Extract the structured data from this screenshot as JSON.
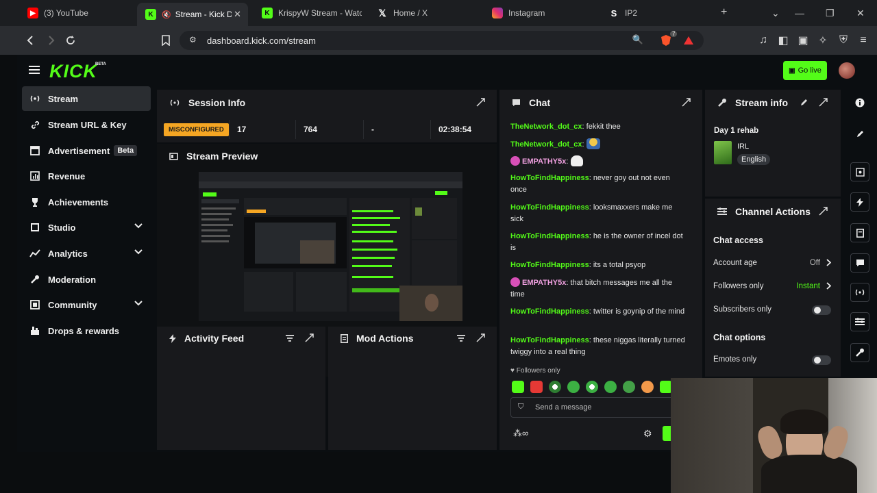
{
  "browser": {
    "tabs": [
      {
        "label": "(3) YouTube",
        "icon": "youtube-icon",
        "color": "#ff0000"
      },
      {
        "label": "Stream - Kick Dashboard",
        "icon": "kick-icon",
        "color": "#53fc18",
        "active": true
      },
      {
        "label": "KrispyW Stream - Watch",
        "icon": "kick-icon",
        "color": "#53fc18"
      },
      {
        "label": "Home / X",
        "icon": "x-icon",
        "color": "#ffffff"
      },
      {
        "label": "Instagram",
        "icon": "instagram-icon",
        "color": "#e1306c"
      },
      {
        "label": "IP2",
        "icon": "s-icon",
        "color": "#ffffff"
      }
    ],
    "url": "dashboard.kick.com/stream",
    "extension_count": "7"
  },
  "app": {
    "logo": "KICK",
    "logo_badge": "BETA",
    "go_live_label": "Go live",
    "accent": "#53fc18"
  },
  "sidebar": {
    "items": [
      {
        "label": "Stream",
        "icon": "broadcast-icon"
      },
      {
        "label": "Stream URL & Key",
        "icon": "link-icon"
      },
      {
        "label": "Advertisement",
        "badge": "Beta",
        "icon": "ad-icon"
      },
      {
        "label": "Revenue",
        "icon": "bar-chart-icon"
      },
      {
        "label": "Achievements",
        "icon": "trophy-icon"
      },
      {
        "label": "Studio",
        "icon": "studio-icon"
      },
      {
        "label": "Analytics",
        "icon": "analytics-icon"
      },
      {
        "label": "Moderation",
        "icon": "wrench-icon"
      },
      {
        "label": "Community",
        "icon": "community-icon"
      },
      {
        "label": "Drops & rewards",
        "icon": "drops-icon"
      }
    ]
  },
  "session": {
    "title": "Session Info",
    "status": "MISCONFIGURED",
    "stat1": "17",
    "stat2": "764",
    "stat3": "-",
    "duration": "02:38:54"
  },
  "preview": {
    "title": "Stream Preview"
  },
  "activity": {
    "title": "Activity Feed"
  },
  "mod_actions": {
    "title": "Mod Actions"
  },
  "chat": {
    "title": "Chat",
    "messages": [
      {
        "user": "TheNetwork_dot_cx",
        "text": "fekkit thee"
      },
      {
        "user": "TheNetwork_dot_cx",
        "text": ""
      },
      {
        "user": "EMPATHY5x",
        "text": ""
      },
      {
        "user": "HowToFindHappiness",
        "text": "never goy out not even once"
      },
      {
        "user": "HowToFindHappiness",
        "text": "looksmaxxers make me sick"
      },
      {
        "user": "HowToFindHappiness",
        "text": "he is the owner of incel dot is"
      },
      {
        "user": "HowToFindHappiness",
        "text": "its a total psyop"
      },
      {
        "user": "EMPATHY5x",
        "text": "that bitch messages me all the time"
      },
      {
        "user": "HowToFindHappiness",
        "text": "twitter is goynip of the mind"
      },
      {
        "user": "HowToFindHappiness",
        "text": "these niggas literally turned twiggy into a real thing"
      }
    ],
    "mode_label": "Followers only",
    "input_placeholder": "Send a message"
  },
  "stream_info": {
    "title": "Stream info",
    "stream_title": "Day 1 rehab",
    "category": "IRL",
    "language": "English"
  },
  "channel_actions": {
    "title": "Channel Actions",
    "chat_access_heading": "Chat access",
    "account_age_label": "Account age",
    "account_age_value": "Off",
    "followers_only_label": "Followers only",
    "followers_only_value": "Instant",
    "subscribers_only_label": "Subscribers only",
    "chat_options_heading": "Chat options",
    "emotes_only_label": "Emotes only"
  }
}
